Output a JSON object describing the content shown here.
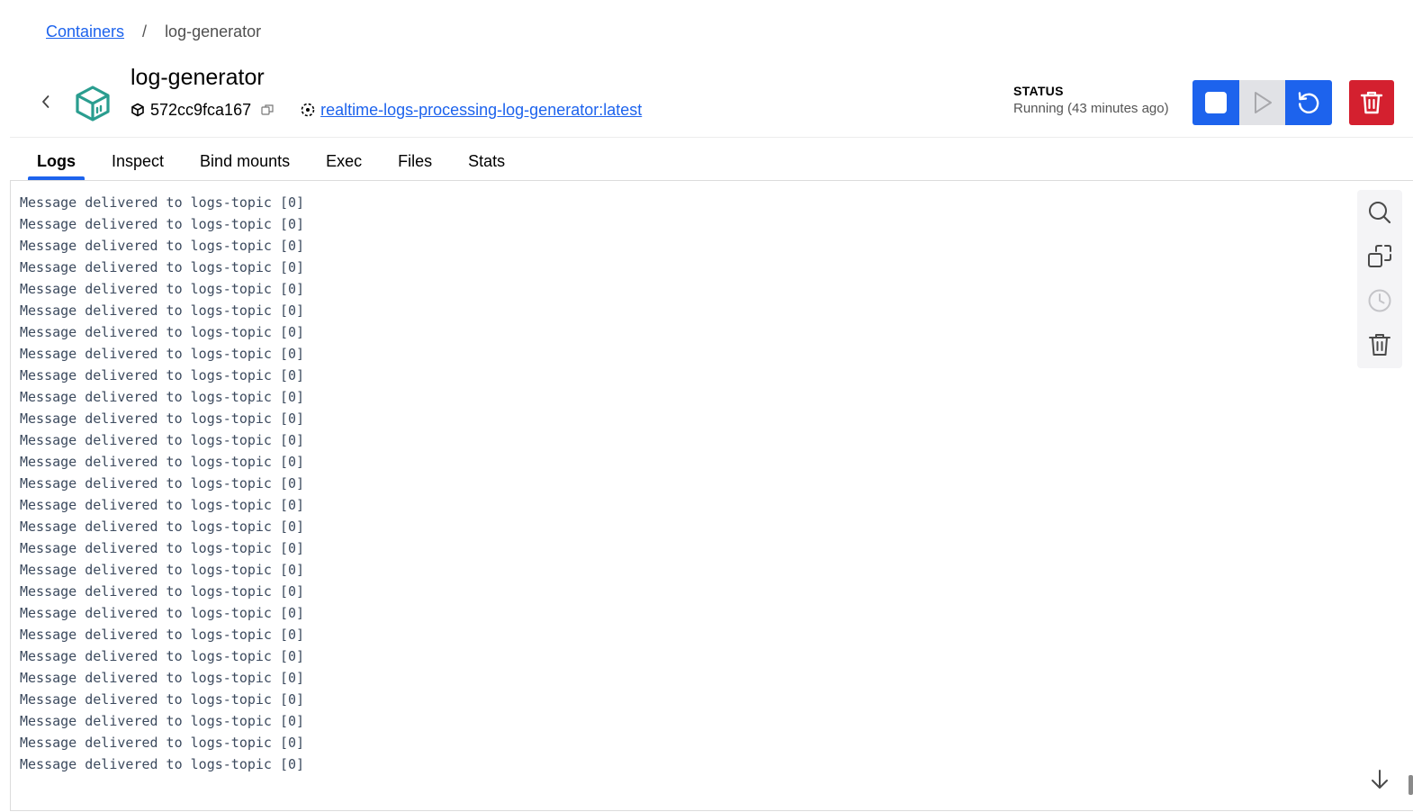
{
  "breadcrumb": {
    "parent": "Containers",
    "separator": "/",
    "current": "log-generator"
  },
  "container": {
    "name": "log-generator",
    "id": "572cc9fca167",
    "image": "realtime-logs-processing-log-generator:latest"
  },
  "status": {
    "label": "STATUS",
    "value": "Running (43 minutes ago)"
  },
  "actions": {
    "stop": "stop-icon",
    "start": "play-icon",
    "restart": "restart-icon",
    "delete": "trash-icon"
  },
  "tabs": [
    {
      "label": "Logs",
      "active": true
    },
    {
      "label": "Inspect",
      "active": false
    },
    {
      "label": "Bind mounts",
      "active": false
    },
    {
      "label": "Exec",
      "active": false
    },
    {
      "label": "Files",
      "active": false
    },
    {
      "label": "Stats",
      "active": false
    }
  ],
  "logs": {
    "lines": [
      "Message delivered to logs-topic [0]",
      "Message delivered to logs-topic [0]",
      "Message delivered to logs-topic [0]",
      "Message delivered to logs-topic [0]",
      "Message delivered to logs-topic [0]",
      "Message delivered to logs-topic [0]",
      "Message delivered to logs-topic [0]",
      "Message delivered to logs-topic [0]",
      "Message delivered to logs-topic [0]",
      "Message delivered to logs-topic [0]",
      "Message delivered to logs-topic [0]",
      "Message delivered to logs-topic [0]",
      "Message delivered to logs-topic [0]",
      "Message delivered to logs-topic [0]",
      "Message delivered to logs-topic [0]",
      "Message delivered to logs-topic [0]",
      "Message delivered to logs-topic [0]",
      "Message delivered to logs-topic [0]",
      "Message delivered to logs-topic [0]",
      "Message delivered to logs-topic [0]",
      "Message delivered to logs-topic [0]",
      "Message delivered to logs-topic [0]",
      "Message delivered to logs-topic [0]",
      "Message delivered to logs-topic [0]",
      "Message delivered to logs-topic [0]",
      "Message delivered to logs-topic [0]",
      "Message delivered to logs-topic [0]"
    ]
  },
  "colors": {
    "accent": "#1d63ed",
    "danger": "#d4202f",
    "container_icon": "#2a9d8f"
  }
}
